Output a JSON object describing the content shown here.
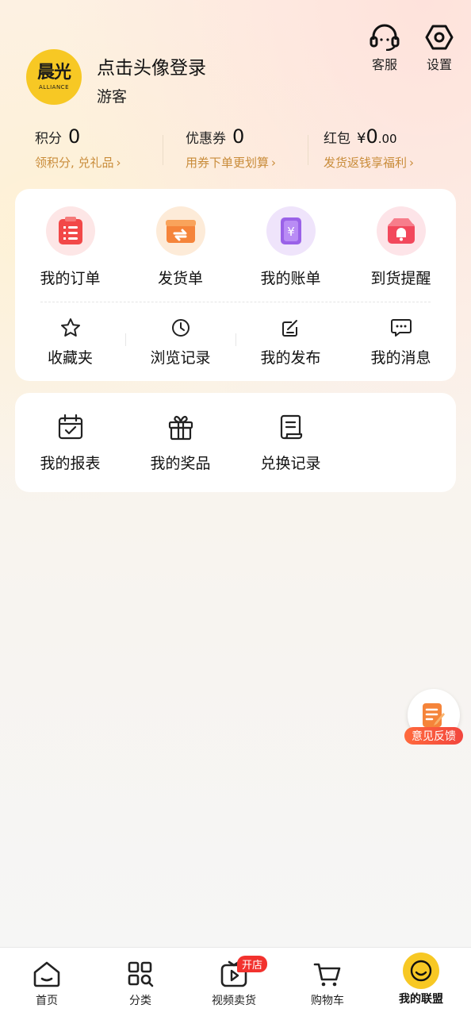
{
  "header": {
    "avatar_logo_main": "晨光",
    "avatar_logo_sub": "ALLIANCE",
    "login_title": "点击头像登录",
    "user_label": "游客",
    "customer_service_label": "客服",
    "settings_label": "设置"
  },
  "stats": [
    {
      "key": "积分",
      "value": "0",
      "sub": "领积分, 兑礼品"
    },
    {
      "key": "优惠券",
      "value": "0",
      "sub": "用券下单更划算"
    },
    {
      "key": "红包",
      "currency": "¥",
      "value": "0",
      "decimals": ".00",
      "sub": "发货返钱享福利"
    }
  ],
  "orders": [
    {
      "label": "我的订单",
      "icon": "order-list-icon"
    },
    {
      "label": "发货单",
      "icon": "shipment-box-icon"
    },
    {
      "label": "我的账单",
      "icon": "bill-yen-icon"
    },
    {
      "label": "到货提醒",
      "icon": "arrival-bell-icon"
    }
  ],
  "shortcuts": [
    {
      "label": "收藏夹",
      "icon": "star-icon"
    },
    {
      "label": "浏览记录",
      "icon": "clock-icon"
    },
    {
      "label": "我的发布",
      "icon": "edit-icon"
    },
    {
      "label": "我的消息",
      "icon": "message-icon"
    }
  ],
  "tools": [
    {
      "label": "我的报表",
      "icon": "calendar-check-icon"
    },
    {
      "label": "我的奖品",
      "icon": "gift-icon"
    },
    {
      "label": "兑换记录",
      "icon": "document-icon"
    }
  ],
  "feedback_label": "意见反馈",
  "tabbar": [
    {
      "label": "首页",
      "icon": "home-icon"
    },
    {
      "label": "分类",
      "icon": "category-grid-icon"
    },
    {
      "label": "视频卖货",
      "icon": "video-play-icon",
      "badge": "开店"
    },
    {
      "label": "购物车",
      "icon": "cart-icon"
    },
    {
      "label": "我的联盟",
      "icon": "smile-icon",
      "active": true
    }
  ],
  "colors": {
    "accent": "#f7c824",
    "sub_text": "#c98c3a",
    "badge": "#f2322e"
  }
}
